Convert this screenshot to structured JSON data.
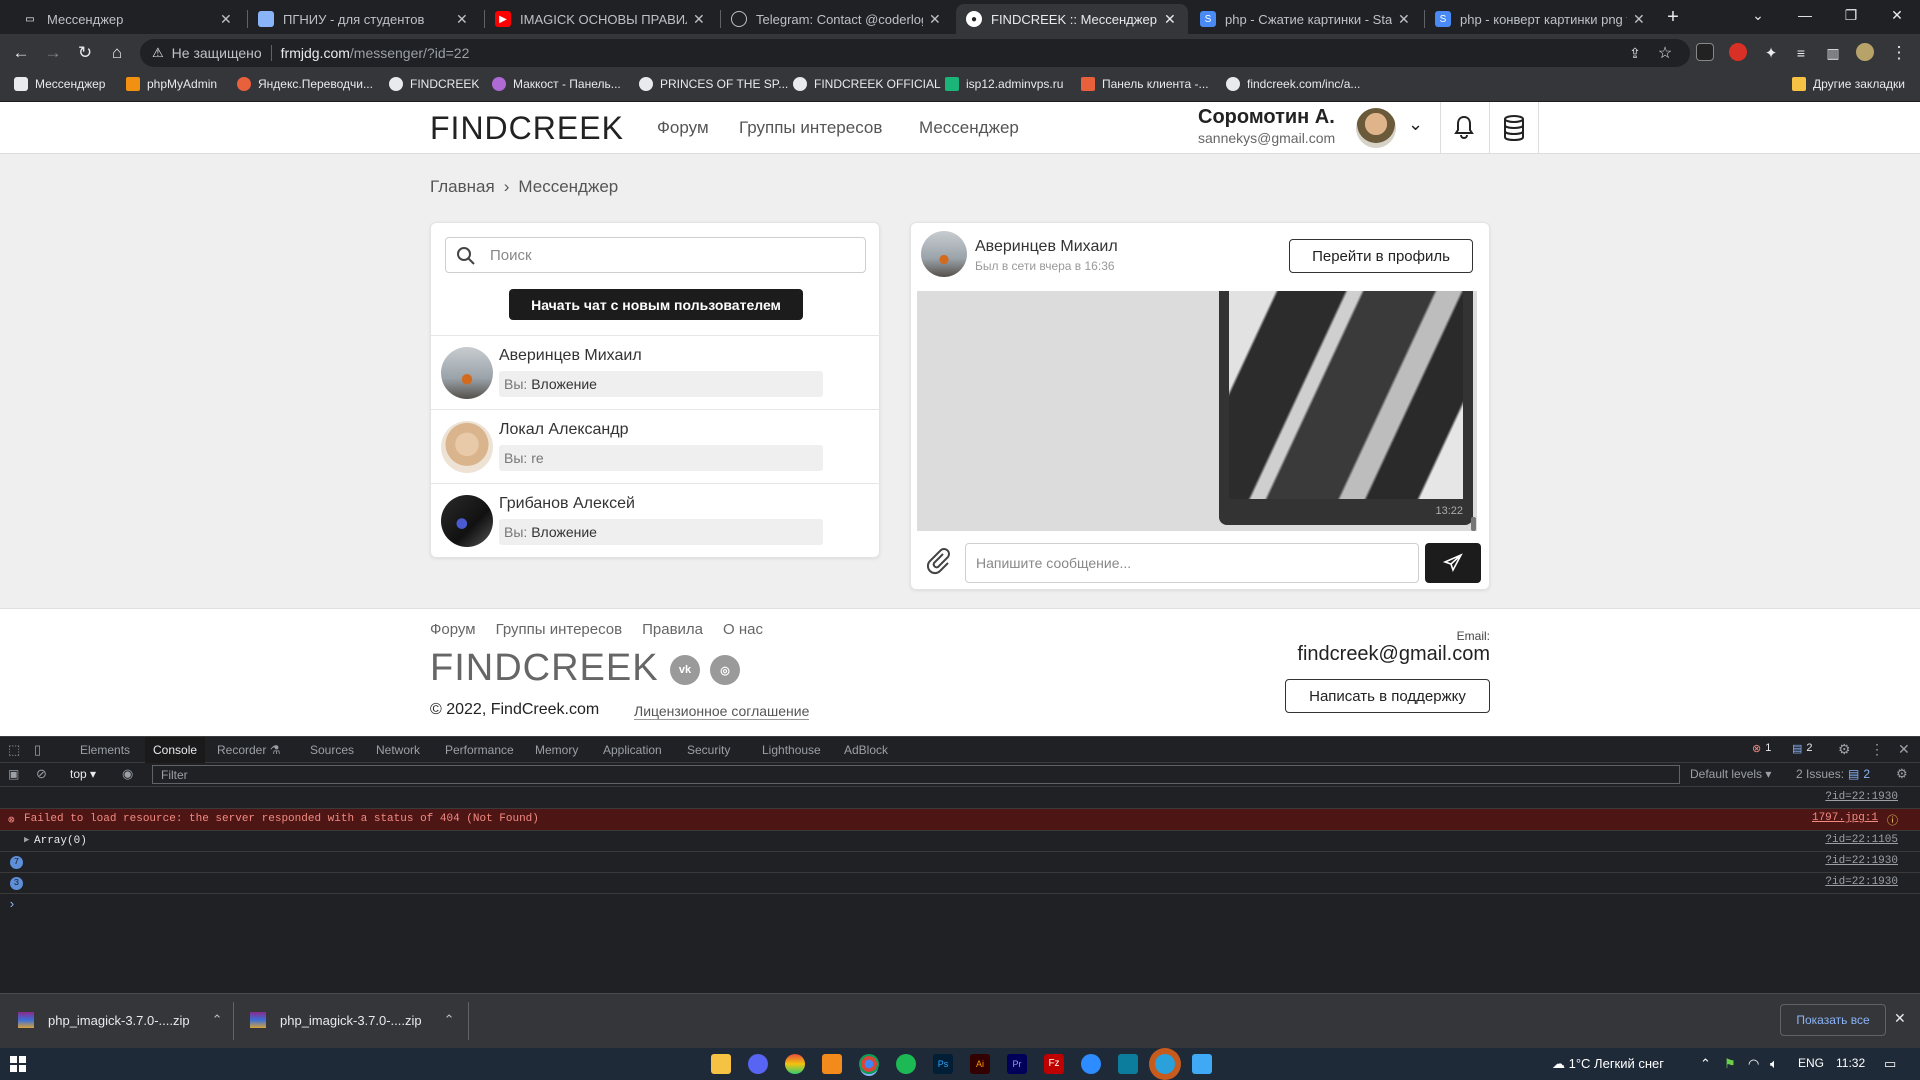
{
  "tabs": [
    {
      "title": "Мессенджер",
      "active": false
    },
    {
      "title": "ПГНИУ - для студентов",
      "active": false
    },
    {
      "title": "IMAGICK ОСНОВЫ ПРАВИЛЬН",
      "active": false
    },
    {
      "title": "Telegram: Contact @coderlog_c",
      "active": false
    },
    {
      "title": "FINDCREEK :: Мессенджер",
      "active": true
    },
    {
      "title": "php - Сжатие картинки - Stack",
      "active": false
    },
    {
      "title": "php - конверт картинки png to",
      "active": false
    }
  ],
  "address": {
    "security_label": "Не защищено",
    "host": "frmjdg.com",
    "path": "/messenger/?id=22"
  },
  "bookmarks": [
    "Мессенджер",
    "phpMyAdmin",
    "Яндекс.Переводчи...",
    "FINDCREEK",
    "Маккост - Панель...",
    "PRINCES OF THE SP...",
    "FINDCREEK OFFICIAL",
    "isp12.adminvps.ru",
    "Панель клиента -...",
    "findcreek.com/inc/a..."
  ],
  "other_bookmarks": "Другие закладки",
  "site": {
    "logo": "FINDCREEK",
    "nav": [
      "Форум",
      "Группы интересов",
      "Мессенджер"
    ],
    "user": {
      "name": "Соромотин А.",
      "email": "sannekys@gmail.com"
    },
    "breadcrumb": {
      "home": "Главная",
      "separator": "›",
      "current": "Мессенджер"
    }
  },
  "sidebar": {
    "search_placeholder": "Поиск",
    "new_chat_label": "Начать чат с новым пользователем",
    "chats": [
      {
        "name": "Аверинцев Михаил",
        "prefix": "Вы:",
        "preview": "Вложение"
      },
      {
        "name": "Локал Александр",
        "prefix": "Вы:",
        "preview": "re"
      },
      {
        "name": "Грибанов Алексей",
        "prefix": "Вы:",
        "preview": "Вложение"
      }
    ]
  },
  "chat": {
    "name": "Аверинцев Михаил",
    "status": "Был в сети вчера в 16:36",
    "profile_button": "Перейти в профиль",
    "message_time": "13:22",
    "input_placeholder": "Напишите сообщение..."
  },
  "footer": {
    "links": [
      "Форум",
      "Группы интересов",
      "Правила",
      "О нас"
    ],
    "logo": "FINDCREEK",
    "social": [
      "vk",
      "ig"
    ],
    "copyright": "© 2022, FindCreek.com",
    "license": "Лицензионное соглашение",
    "email_label": "Email:",
    "email": "findcreek@gmail.com",
    "support_button": "Написать в поддержку"
  },
  "devtools": {
    "tabs": [
      "Elements",
      "Console",
      "Recorder ⚗",
      "Sources",
      "Network",
      "Performance",
      "Memory",
      "Application",
      "Security",
      "Lighthouse",
      "AdBlock"
    ],
    "active_tab": "Console",
    "error_count": "1",
    "message_count": "2",
    "context": "top",
    "filter_placeholder": "Filter",
    "levels": "Default levels",
    "issues_label": "2 Issues:",
    "issues_count": "2",
    "rows": [
      {
        "text": "",
        "source": "?id=22:1930"
      },
      {
        "text": "Failed to load resource: the server responded with a status of 404 (Not Found)",
        "source": "1797.jpg:1"
      },
      {
        "text": "Array(0)",
        "source": "?id=22:1105"
      },
      {
        "text": "7",
        "source": "?id=22:1930"
      },
      {
        "text": "3",
        "source": "?id=22:1930"
      }
    ],
    "prompt": "›"
  },
  "downloads": {
    "items": [
      "php_imagick-3.7.0-....zip",
      "php_imagick-3.7.0-....zip"
    ],
    "show_all": "Показать все"
  },
  "taskbar": {
    "weather": "1°C  Легкий снег",
    "lang": "ENG",
    "time": "11:32"
  },
  "colors": {
    "accent_dark": "#222222",
    "error_bg": "#4e1515",
    "error_text": "#f28b82",
    "taskbar": "#1f2a38"
  }
}
